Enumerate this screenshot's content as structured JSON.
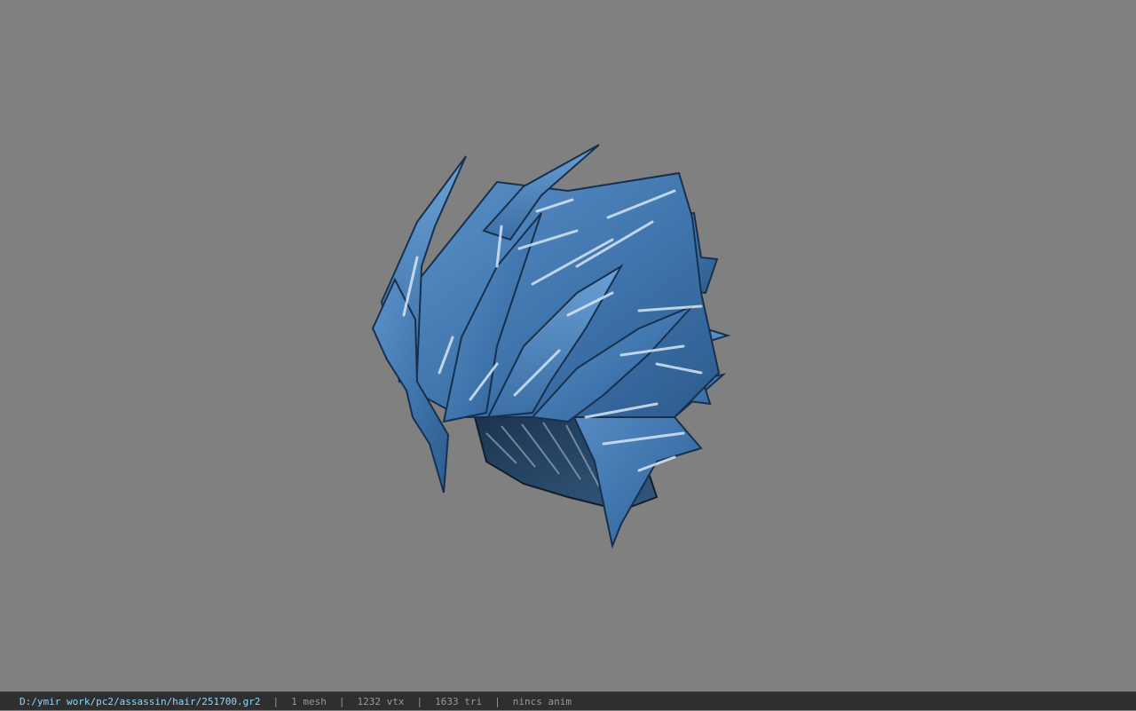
{
  "viewport": {
    "background": "#808080",
    "model": {
      "icon": "hair-mesh-render",
      "base_color": "#4a7fb8",
      "highlight_color": "#d6e6f4",
      "shadow_color": "#17304d"
    }
  },
  "statusbar": {
    "path": "D:/ymir work/pc2/assassin/hair/251700.gr2",
    "separator": "|",
    "mesh_count": "1 mesh",
    "vertex_count": "1232 vtx",
    "triangle_count": "1633 tri",
    "anim_state": "nincs anim"
  }
}
